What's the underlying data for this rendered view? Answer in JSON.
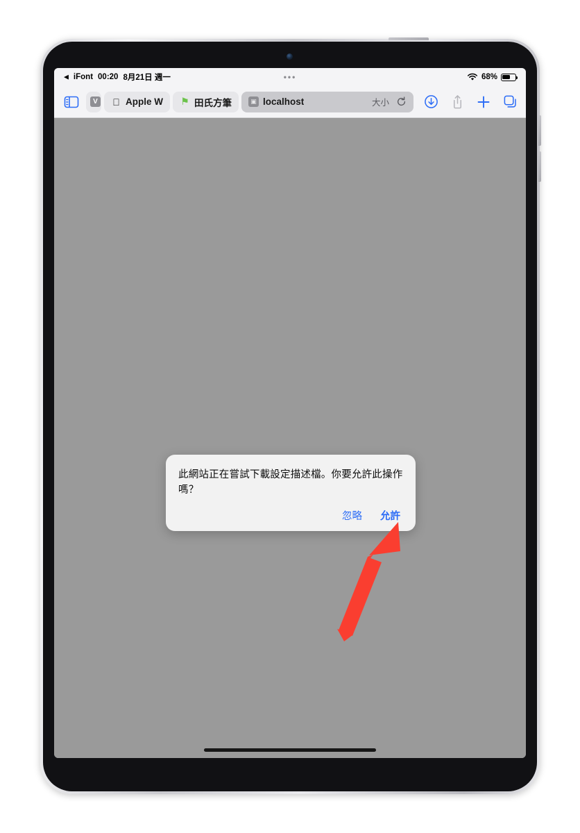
{
  "status_bar": {
    "back_app": "iFont",
    "back_chevron": "◀",
    "time": "00:20",
    "date": "8月21日 週一",
    "center_dots": "•••",
    "wifi_icon": "wifi-icon",
    "battery_percent": "68%",
    "battery_level": 68
  },
  "toolbar": {
    "sidebar_icon": "sidebar-icon",
    "downloads_icon": "downloads-icon",
    "share_icon": "share-icon",
    "new_tab_icon": "plus-icon",
    "tabs_overview_icon": "tab-overview-icon"
  },
  "tabs": [
    {
      "label": "",
      "favicon": "letter-v-favicon",
      "favicon_text": "V",
      "active": false,
      "clipped": true
    },
    {
      "label": "Apple W",
      "favicon": "apple-logo-favicon",
      "favicon_text": "",
      "active": false,
      "clipped": false
    },
    {
      "label": "田氏方筆",
      "favicon": "green-flag-favicon",
      "favicon_text": "⚑",
      "active": false,
      "clipped": false
    },
    {
      "label": "localhost",
      "favicon": "placeholder-favicon",
      "favicon_text": "▣",
      "active": true,
      "clipped": false
    }
  ],
  "address_bar": {
    "size_label": "大小",
    "reload_icon": "reload-icon"
  },
  "dialog": {
    "message": "此網站正在嘗試下載設定描述檔。你要允許此操作嗎？",
    "ignore_label": "忽略",
    "allow_label": "允許"
  },
  "annotation": {
    "arrow_color": "#FA3E30",
    "arrow_target": "allow-button"
  },
  "colors": {
    "page_background": "#9a9a9a",
    "toolbar_background": "#f4f4f6",
    "accent_blue": "#2d6df6",
    "dialog_background": "#f2f2f2"
  }
}
